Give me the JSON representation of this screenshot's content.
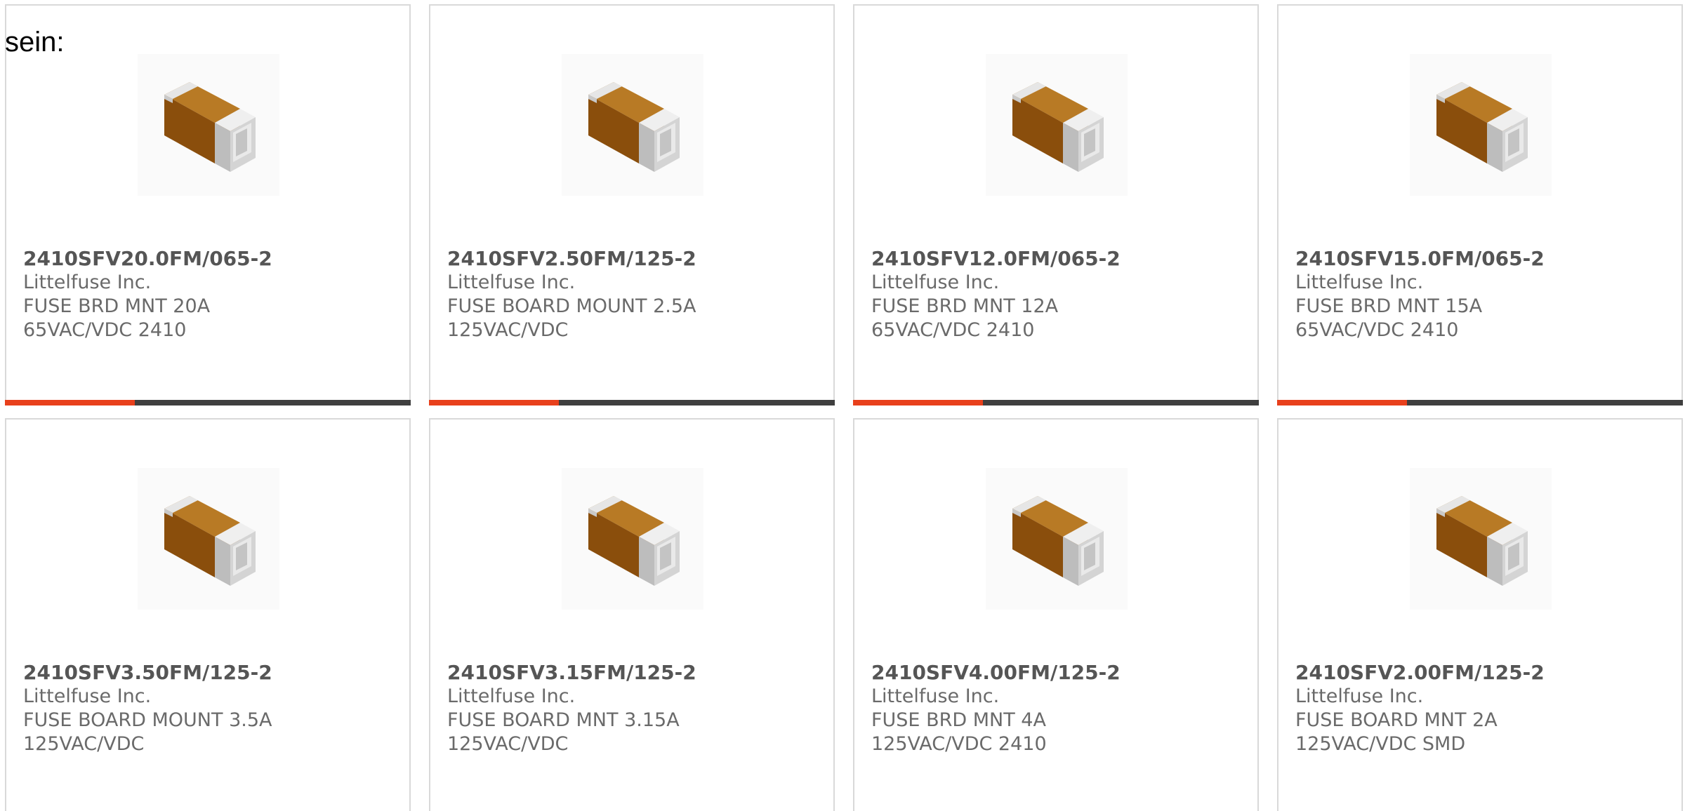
{
  "heading": "sein:",
  "colors": {
    "accent": "#e8401c",
    "bar_track": "#3f3f3f",
    "card_border": "#d9d9d9",
    "text": "#6a6a6a",
    "part_text": "#555555",
    "fuse_body": "#9a5a10",
    "fuse_terminal": "#d8d8d8"
  },
  "product_icon": "smd-fuse-image",
  "products": [
    {
      "part": "2410SFV20.0FM/065-2",
      "maker": "Littelfuse Inc.",
      "desc": "FUSE BRD MNT 20A 65VAC/VDC 2410",
      "progress": 0.32
    },
    {
      "part": "2410SFV2.50FM/125-2",
      "maker": "Littelfuse Inc.",
      "desc": "FUSE BOARD MOUNT 2.5A 125VAC/VDC",
      "progress": 0.32
    },
    {
      "part": "2410SFV12.0FM/065-2",
      "maker": "Littelfuse Inc.",
      "desc": "FUSE BRD MNT 12A 65VAC/VDC 2410",
      "progress": 0.32
    },
    {
      "part": "2410SFV15.0FM/065-2",
      "maker": "Littelfuse Inc.",
      "desc": "FUSE BRD MNT 15A 65VAC/VDC 2410",
      "progress": 0.32
    },
    {
      "part": "2410SFV3.50FM/125-2",
      "maker": "Littelfuse Inc.",
      "desc": "FUSE BOARD MOUNT 3.5A 125VAC/VDC",
      "progress": null
    },
    {
      "part": "2410SFV3.15FM/125-2",
      "maker": "Littelfuse Inc.",
      "desc": "FUSE BOARD MNT 3.15A 125VAC/VDC",
      "progress": null
    },
    {
      "part": "2410SFV4.00FM/125-2",
      "maker": "Littelfuse Inc.",
      "desc": "FUSE BRD MNT 4A 125VAC/VDC 2410",
      "progress": null
    },
    {
      "part": "2410SFV2.00FM/125-2",
      "maker": "Littelfuse Inc.",
      "desc": "FUSE BOARD MNT 2A 125VAC/VDC SMD",
      "progress": null
    }
  ]
}
